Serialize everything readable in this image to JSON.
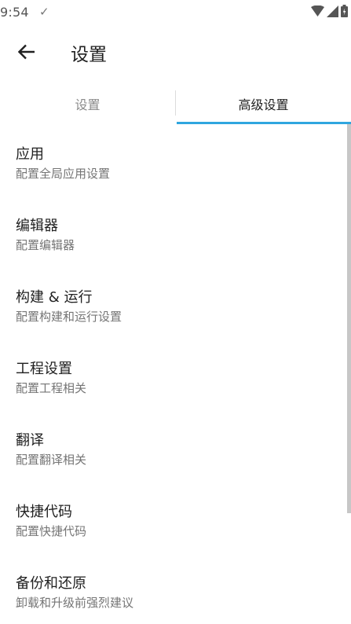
{
  "status_bar": {
    "time": "9:54",
    "check_icon": "check-icon",
    "icons": [
      "wifi-icon",
      "signal-icon",
      "battery-icon"
    ]
  },
  "toolbar": {
    "back_icon": "arrow-left-icon",
    "title": "设置"
  },
  "tabs": [
    {
      "label": "设置",
      "selected": false
    },
    {
      "label": "高级设置",
      "selected": true
    }
  ],
  "colors": {
    "accent": "#2fa6df",
    "text_primary": "#212121",
    "text_secondary": "#757575",
    "tab_inactive": "#8a8a8a"
  },
  "settings": {
    "items": [
      {
        "title": "应用",
        "subtitle": "配置全局应用设置"
      },
      {
        "title": "编辑器",
        "subtitle": "配置编辑器"
      },
      {
        "title": "构建 & 运行",
        "subtitle": "配置构建和运行设置"
      },
      {
        "title": "工程设置",
        "subtitle": "配置工程相关"
      },
      {
        "title": "翻译",
        "subtitle": "配置翻译相关"
      },
      {
        "title": "快捷代码",
        "subtitle": "配置快捷代码"
      },
      {
        "title": "备份和还原",
        "subtitle": "卸载和升级前强烈建议"
      }
    ]
  }
}
